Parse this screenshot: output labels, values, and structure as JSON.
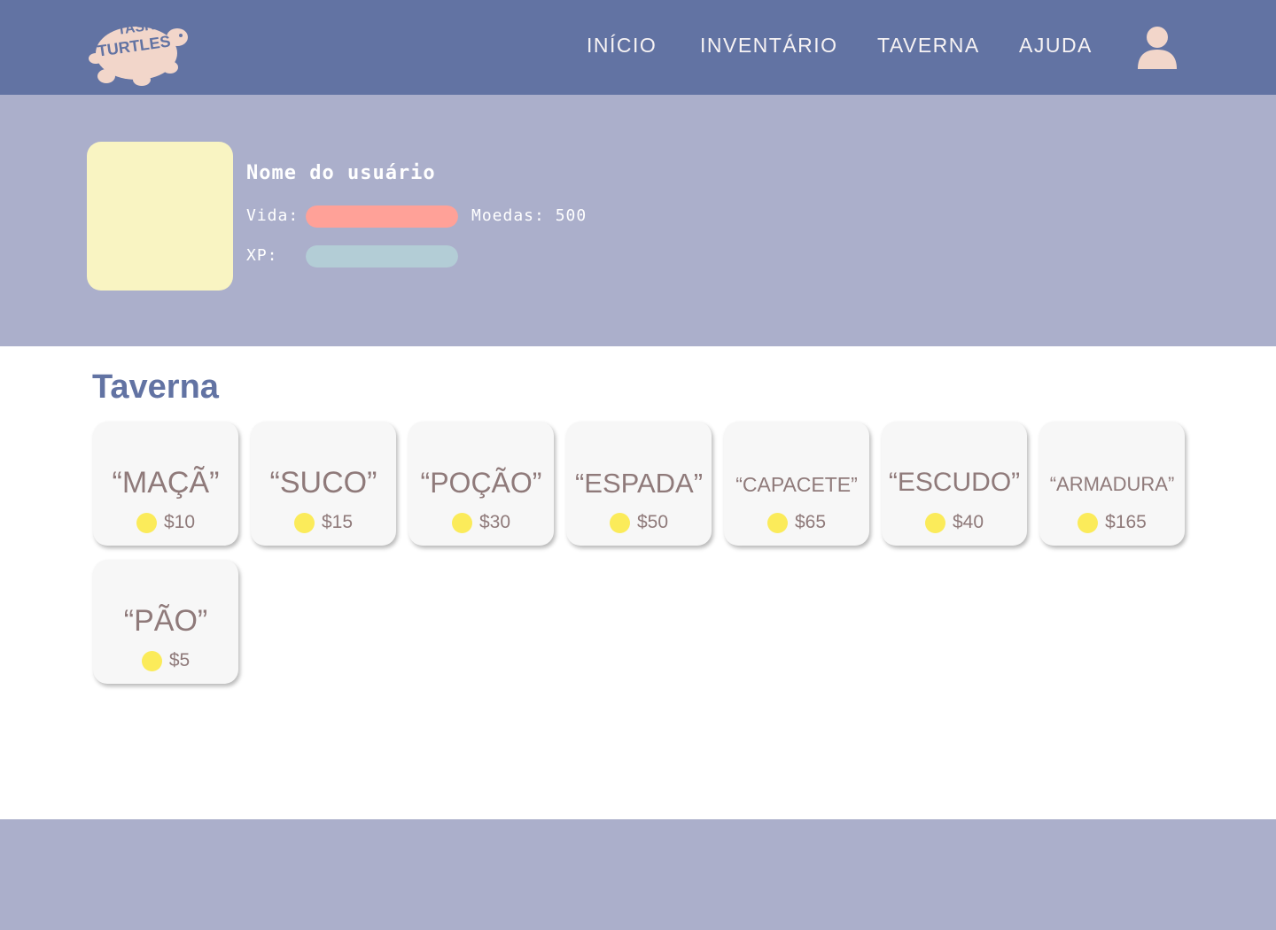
{
  "header": {
    "logo_text": "TASK TURTLES",
    "nav": [
      {
        "label": "INÍCIO"
      },
      {
        "label": "INVENTÁRIO"
      },
      {
        "label": "TAVERNA"
      },
      {
        "label": "AJUDA"
      }
    ]
  },
  "profile": {
    "username": "Nome do usuário",
    "life_label": "Vida:",
    "xp_label": "XP:",
    "coins_label": "Moedas: 500",
    "life_fraction": 1.0,
    "xp_fraction": 1.0
  },
  "tavern": {
    "title": "Taverna",
    "items": [
      {
        "name": "“MAÇÃ”",
        "price": "$10"
      },
      {
        "name": "“SUCO”",
        "price": "$15"
      },
      {
        "name": "“POÇÃO”",
        "price": "$30"
      },
      {
        "name": "“ESPADA”",
        "price": "$50"
      },
      {
        "name": "“CAPACETE”",
        "price": "$65"
      },
      {
        "name": "“ESCUDO”",
        "price": "$40"
      },
      {
        "name": "“ARMADURA”",
        "price": "$165"
      },
      {
        "name": "“PÃO”",
        "price": "$5"
      }
    ]
  },
  "colors": {
    "header_bg": "#6273a3",
    "profile_bg": "#abafcb",
    "avatar_bg": "#f9f4c2",
    "life_bar": "#ffa198",
    "xp_bar": "#b3cdd6",
    "coin": "#fbeb5a",
    "item_text": "#8f7a7a",
    "accent_peach": "#f2d6ca"
  },
  "icons": {
    "logo": "turtle-logo-icon",
    "user": "user-icon",
    "coin": "coin-icon"
  }
}
